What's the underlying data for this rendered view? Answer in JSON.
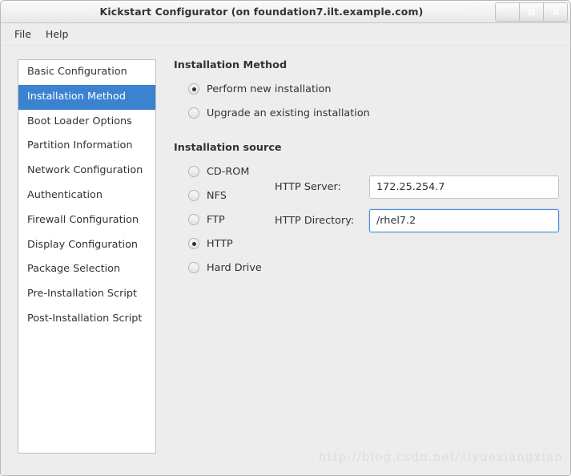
{
  "window": {
    "title": "Kickstart Configurator (on foundation7.ilt.example.com)",
    "controls": {
      "minimize": "minimize-icon",
      "maximize": "maximize-icon",
      "close": "close-icon"
    },
    "accent_color": "#3b83d0",
    "focus_color": "#4a90d9",
    "background_color": "#ededed"
  },
  "menubar": {
    "items": [
      {
        "label": "File"
      },
      {
        "label": "Help"
      }
    ]
  },
  "sidebar": {
    "items": [
      {
        "label": "Basic Configuration",
        "selected": false
      },
      {
        "label": "Installation Method",
        "selected": true
      },
      {
        "label": "Boot Loader Options",
        "selected": false
      },
      {
        "label": "Partition Information",
        "selected": false
      },
      {
        "label": "Network Configuration",
        "selected": false
      },
      {
        "label": "Authentication",
        "selected": false
      },
      {
        "label": "Firewall Configuration",
        "selected": false
      },
      {
        "label": "Display Configuration",
        "selected": false
      },
      {
        "label": "Package Selection",
        "selected": false
      },
      {
        "label": "Pre-Installation Script",
        "selected": false
      },
      {
        "label": "Post-Installation Script",
        "selected": false
      }
    ]
  },
  "main": {
    "method_section": {
      "heading": "Installation Method",
      "options": [
        {
          "label": "Perform new installation",
          "selected": true
        },
        {
          "label": "Upgrade an existing installation",
          "selected": false
        }
      ]
    },
    "source_section": {
      "heading": "Installation source",
      "options": [
        {
          "label": "CD-ROM",
          "selected": false
        },
        {
          "label": "NFS",
          "selected": false
        },
        {
          "label": "FTP",
          "selected": false
        },
        {
          "label": "HTTP",
          "selected": true
        },
        {
          "label": "Hard Drive",
          "selected": false
        }
      ],
      "fields": [
        {
          "label": "HTTP Server:",
          "value": "172.25.254.7",
          "placeholder": "",
          "focused": false
        },
        {
          "label": "HTTP Directory:",
          "value": "/rhel7.2",
          "placeholder": "",
          "focused": true
        }
      ]
    }
  },
  "watermark": {
    "text": "http://blog.csdn.net/siyuexiangxian"
  }
}
